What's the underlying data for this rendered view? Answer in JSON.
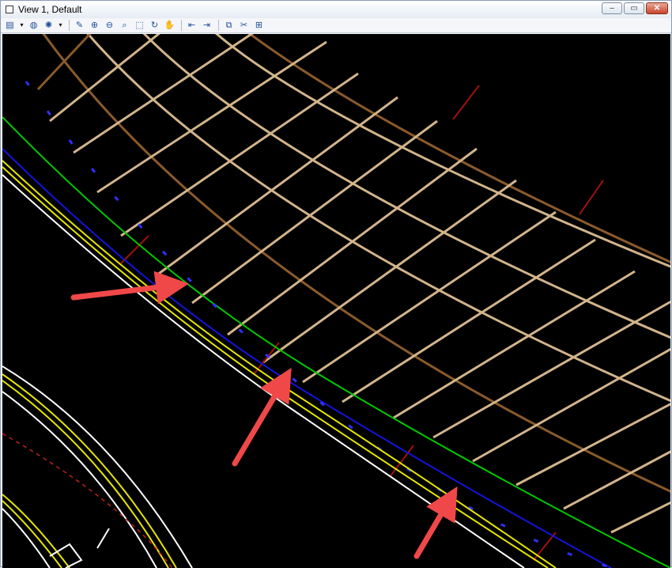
{
  "window": {
    "title": "View 1, Default",
    "minimize_glyph": "–",
    "maximize_glyph": "▭",
    "close_glyph": "✕"
  },
  "toolbar": {
    "items": [
      {
        "name": "view-attributes-icon",
        "glyph": "▤"
      },
      {
        "name": "dropdown-arrow-icon",
        "glyph": "▾"
      },
      {
        "name": "render-icon",
        "glyph": "◍"
      },
      {
        "name": "lighting-icon",
        "glyph": "✺"
      },
      {
        "name": "dropdown-arrow-icon",
        "glyph": "▾"
      },
      {
        "name": "update-view-icon",
        "glyph": "✎"
      },
      {
        "name": "zoom-in-icon",
        "glyph": "⊕"
      },
      {
        "name": "zoom-out-icon",
        "glyph": "⊖"
      },
      {
        "name": "window-area-icon",
        "glyph": "⌕"
      },
      {
        "name": "fit-view-icon",
        "glyph": "⬚"
      },
      {
        "name": "rotate-view-icon",
        "glyph": "↻"
      },
      {
        "name": "pan-view-icon",
        "glyph": "✋"
      },
      {
        "name": "view-previous-icon",
        "glyph": "⇤"
      },
      {
        "name": "view-next-icon",
        "glyph": "⇥"
      },
      {
        "name": "copy-view-icon",
        "glyph": "⧉"
      },
      {
        "name": "clip-volume-icon",
        "glyph": "✂"
      },
      {
        "name": "camera-settings-icon",
        "glyph": "⊞"
      }
    ]
  },
  "colors": {
    "background": "#000000",
    "mesh_light": "#d2b48c",
    "mesh_dark": "#8b5a2b",
    "green_line": "#00c800",
    "blue_line": "#1414dc",
    "yellow_line": "#e6e600",
    "white_line": "#ffffff",
    "red_tick": "#a01010",
    "callout_arrow": "#f04848"
  }
}
